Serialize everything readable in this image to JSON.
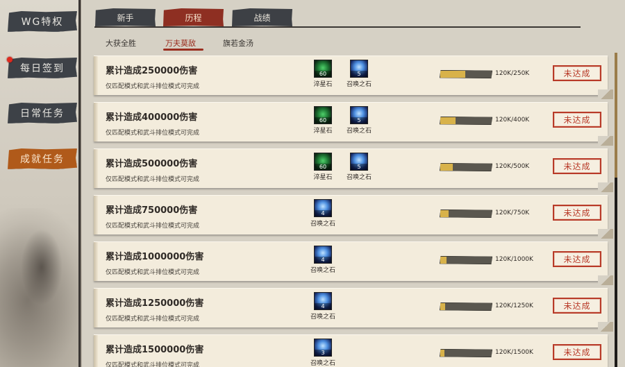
{
  "sidebar": {
    "items": [
      {
        "label": "WG特权",
        "active": false
      },
      {
        "label": "每日签到",
        "active": false,
        "notify": true
      },
      {
        "label": "日常任务",
        "active": false
      },
      {
        "label": "成就任务",
        "active": true
      }
    ]
  },
  "tabs": [
    {
      "label": "新手",
      "active": false
    },
    {
      "label": "历程",
      "active": true
    },
    {
      "label": "战绩",
      "active": false
    }
  ],
  "subtabs": [
    {
      "label": "大获全胜",
      "active": false
    },
    {
      "label": "万夫莫敌",
      "active": true
    },
    {
      "label": "旗若金汤",
      "active": false
    }
  ],
  "colors": {
    "accent_orange": "#b05a1a",
    "tab_active": "#8e2f22",
    "status_red": "#b83a28",
    "progress_gold": "#d8b24a"
  },
  "achievements": [
    {
      "title": "累计造成250000伤害",
      "desc": "仅匹配模式和武斗排位模式可完成",
      "rewards": [
        {
          "icon": "green-stone-icon",
          "qty": "60",
          "name": "淬星石"
        },
        {
          "icon": "blue-crystal-icon",
          "qty": "5",
          "name": "召唤之石"
        }
      ],
      "progress": 0.48,
      "progress_text": "120K/250K",
      "status": "未达成"
    },
    {
      "title": "累计造成400000伤害",
      "desc": "仅匹配模式和武斗排位模式可完成",
      "rewards": [
        {
          "icon": "green-stone-icon",
          "qty": "60",
          "name": "淬星石"
        },
        {
          "icon": "blue-crystal-icon",
          "qty": "5",
          "name": "召唤之石"
        }
      ],
      "progress": 0.3,
      "progress_text": "120K/400K",
      "status": "未达成"
    },
    {
      "title": "累计造成500000伤害",
      "desc": "仅匹配模式和武斗排位模式可完成",
      "rewards": [
        {
          "icon": "green-stone-icon",
          "qty": "60",
          "name": "淬星石"
        },
        {
          "icon": "blue-crystal-icon",
          "qty": "5",
          "name": "召唤之石"
        }
      ],
      "progress": 0.24,
      "progress_text": "120K/500K",
      "status": "未达成"
    },
    {
      "title": "累计造成750000伤害",
      "desc": "仅匹配模式和武斗排位模式可完成",
      "rewards": [
        {
          "icon": "blue-crystal-icon",
          "qty": "4",
          "name": "召唤之石"
        }
      ],
      "progress": 0.16,
      "progress_text": "120K/750K",
      "status": "未达成"
    },
    {
      "title": "累计造成1000000伤害",
      "desc": "仅匹配模式和武斗排位模式可完成",
      "rewards": [
        {
          "icon": "blue-crystal-icon",
          "qty": "4",
          "name": "召唤之石"
        }
      ],
      "progress": 0.12,
      "progress_text": "120K/1000K",
      "status": "未达成"
    },
    {
      "title": "累计造成1250000伤害",
      "desc": "仅匹配模式和武斗排位模式可完成",
      "rewards": [
        {
          "icon": "blue-crystal-icon",
          "qty": "4",
          "name": "召唤之石"
        }
      ],
      "progress": 0.096,
      "progress_text": "120K/1250K",
      "status": "未达成"
    },
    {
      "title": "累计造成1500000伤害",
      "desc": "仅匹配模式和武斗排位模式可完成",
      "rewards": [
        {
          "icon": "blue-crystal-icon",
          "qty": "3",
          "name": "召唤之石"
        }
      ],
      "progress": 0.08,
      "progress_text": "120K/1500K",
      "status": "未达成"
    }
  ]
}
